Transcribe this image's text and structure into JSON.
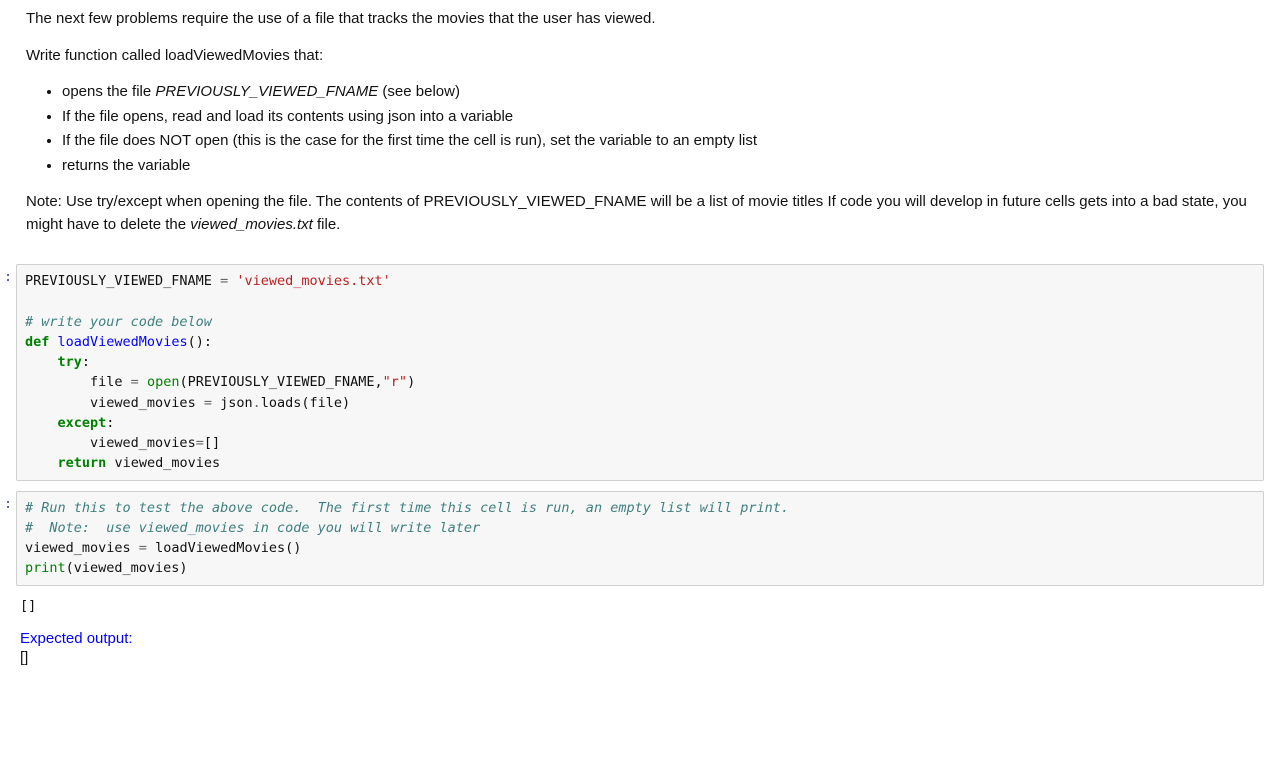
{
  "markdown": {
    "intro1": "The next few problems require the use of a file that tracks the movies that the user has viewed.",
    "intro2": "Write function called loadViewedMovies that:",
    "bullet1_pre": "opens the file ",
    "bullet1_em": "PREVIOUSLY_VIEWED_FNAME",
    "bullet1_post": " (see below)",
    "bullet2": "If the file opens, read and load its contents using json into a variable",
    "bullet3": "If the file does NOT open (this is the case for the first time the cell is run), set the variable to an empty list",
    "bullet4": "returns the variable",
    "note_pre": "Note: Use try/except when opening the file. The contents of PREVIOUSLY_VIEWED_FNAME will be a list of movie titles If code you will develop in future cells gets into a bad state, you might have to delete the ",
    "note_em": "viewed_movies.txt",
    "note_post": " file."
  },
  "prompts": {
    "in1": ":",
    "in2": ":"
  },
  "code1": {
    "l1_a": "PREVIOUSLY_VIEWED_FNAME ",
    "l1_eq": "=",
    "l1_sp": " ",
    "l1_s": "'viewed_movies.txt'",
    "l2": "",
    "l3_c": "# write your code below",
    "l4_k": "def",
    "l4_sp": " ",
    "l4_nf": "loadViewedMovies",
    "l4_p": "():",
    "l5_pad": "    ",
    "l5_k": "try",
    "l5_p": ":",
    "l6_pad": "        ",
    "l6_a": "file ",
    "l6_eq": "=",
    "l6_sp": " ",
    "l6_nb": "open",
    "l6_p1": "(PREVIOUSLY_VIEWED_FNAME,",
    "l6_s": "\"r\"",
    "l6_p2": ")",
    "l7_pad": "        ",
    "l7_a": "viewed_movies ",
    "l7_eq": "=",
    "l7_sp": " ",
    "l7_b": "json",
    "l7_dot": ".",
    "l7_c": "loads(file)",
    "l8_pad": "    ",
    "l8_k": "except",
    "l8_p": ":",
    "l9_pad": "        ",
    "l9_a": "viewed_movies",
    "l9_eq": "=",
    "l9_b": "[]",
    "l10_pad": "    ",
    "l10_k": "return",
    "l10_sp": " ",
    "l10_a": "viewed_movies"
  },
  "code2": {
    "l1_c": "# Run this to test the above code.  The first time this cell is run, an empty list will print.",
    "l2_c": "#  Note:  use viewed_movies in code you will write later",
    "l3_a": "viewed_movies ",
    "l3_eq": "=",
    "l3_sp": " ",
    "l3_b": "loadViewedMovies()",
    "l4_nb": "print",
    "l4_p": "(viewed_movies)"
  },
  "output": {
    "text": "[]"
  },
  "expected": {
    "label": "Expected output:",
    "value": "[]"
  }
}
